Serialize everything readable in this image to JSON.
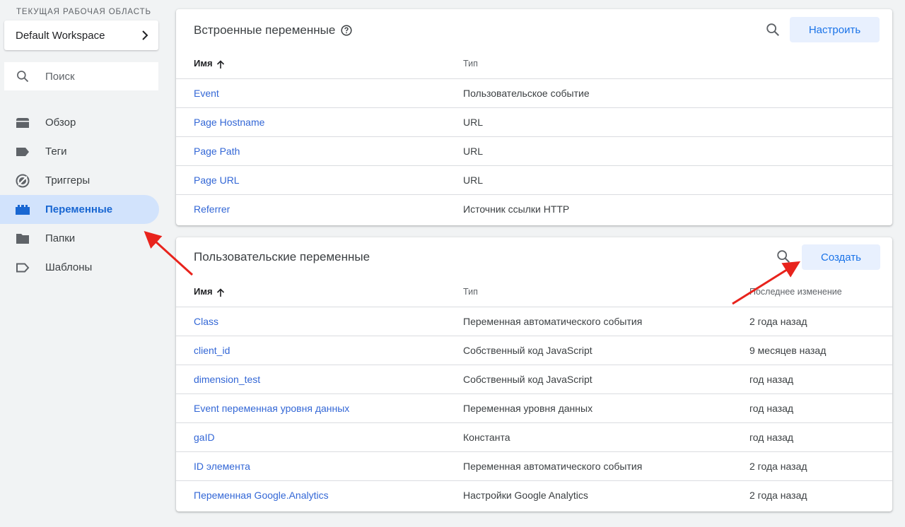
{
  "sidebar": {
    "workspace_label": "ТЕКУЩАЯ РАБОЧАЯ ОБЛАСТЬ",
    "workspace_name": "Default Workspace",
    "search_placeholder": "Поиск",
    "items": [
      {
        "label": "Обзор",
        "icon": "overview-icon"
      },
      {
        "label": "Теги",
        "icon": "tag-icon"
      },
      {
        "label": "Триггеры",
        "icon": "trigger-icon"
      },
      {
        "label": "Переменные",
        "icon": "variables-icon",
        "active": true
      },
      {
        "label": "Папки",
        "icon": "folder-icon"
      },
      {
        "label": "Шаблоны",
        "icon": "template-icon"
      }
    ]
  },
  "builtin": {
    "title": "Встроенные переменные",
    "button": "Настроить",
    "columns": [
      "Имя",
      "Тип"
    ],
    "rows": [
      {
        "name": "Event",
        "type": "Пользовательское событие"
      },
      {
        "name": "Page Hostname",
        "type": "URL"
      },
      {
        "name": "Page Path",
        "type": "URL"
      },
      {
        "name": "Page URL",
        "type": "URL"
      },
      {
        "name": "Referrer",
        "type": "Источник ссылки HTTP"
      }
    ]
  },
  "custom": {
    "title": "Пользовательские переменные",
    "button": "Создать",
    "columns": [
      "Имя",
      "Тип",
      "Последнее изменение"
    ],
    "rows": [
      {
        "name": "Class",
        "type": "Переменная автоматического события",
        "modified": "2 года назад"
      },
      {
        "name": "client_id",
        "type": "Собственный код JavaScript",
        "modified": "9 месяцев назад"
      },
      {
        "name": "dimension_test",
        "type": "Собственный код JavaScript",
        "modified": "год назад"
      },
      {
        "name": "Event переменная уровня данных",
        "type": "Переменная уровня данных",
        "modified": "год назад"
      },
      {
        "name": "gaID",
        "type": "Константа",
        "modified": "год назад"
      },
      {
        "name": "ID элемента",
        "type": "Переменная автоматического события",
        "modified": "2 года назад"
      },
      {
        "name": "Переменная Google.Analytics",
        "type": "Настройки Google Analytics",
        "modified": "2 года назад"
      }
    ]
  },
  "colors": {
    "accent": "#1a73e8",
    "active_bg": "#d2e3fc",
    "annotation_arrow": "#e8231c"
  }
}
